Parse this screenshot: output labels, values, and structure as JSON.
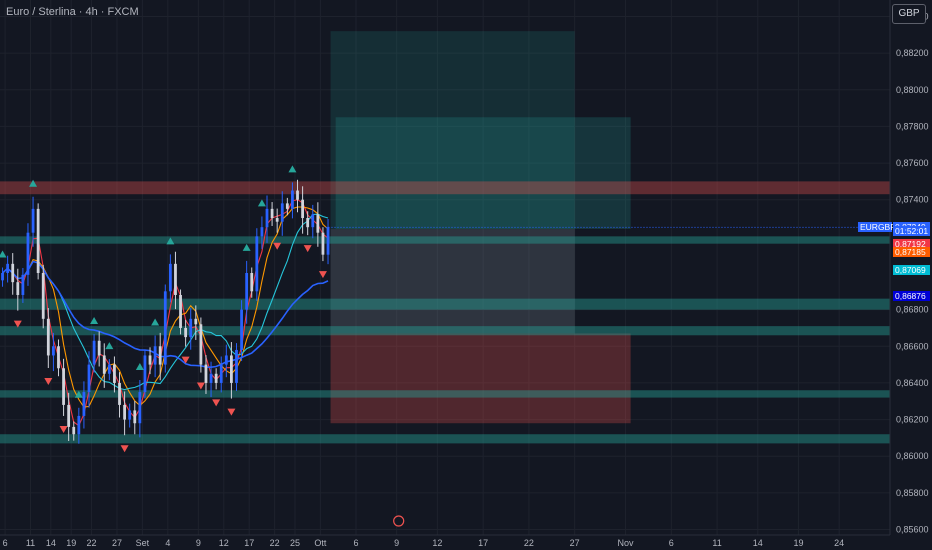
{
  "header": {
    "title": "Euro / Sterlina · 4h · FXCM",
    "currency_button": "GBP"
  },
  "colors": {
    "background": "#131722",
    "up": "#26a69a",
    "down": "#ef5350",
    "candle_up": "#2962ff",
    "candle_down": "#d1d4dc",
    "zone_teal": "#26a69a",
    "zone_red": "#ef5350"
  },
  "price_labels": {
    "symbol_tag": "EURGBP",
    "last": "0,87249",
    "countdown": "01:52:01",
    "ma_red": "0,87192",
    "ma_orange": "0,87185",
    "ma_cyan": "0,87069",
    "ma_blue": "0,86876"
  },
  "chart_data": {
    "type": "candlestick",
    "symbol": "EURGBP",
    "timeframe": "4h",
    "y_ticks": [
      "0,88400",
      "0,88200",
      "0,88000",
      "0,87800",
      "0,87600",
      "0,87400",
      "0,86800",
      "0,86600",
      "0,86400",
      "0,86200",
      "0,86000",
      "0,85800",
      "0,85600"
    ],
    "y_tick_values": [
      0.884,
      0.882,
      0.88,
      0.878,
      0.876,
      0.874,
      0.868,
      0.866,
      0.864,
      0.862,
      0.86,
      0.858,
      0.856
    ],
    "ylim": [
      0.8557,
      0.8849
    ],
    "x_ticks": [
      "6",
      "11",
      "14",
      "19",
      "22",
      "27",
      "Set",
      "4",
      "9",
      "12",
      "17",
      "22",
      "25",
      "Ott",
      "6",
      "9",
      "12",
      "17",
      "22",
      "27",
      "Nov",
      "6",
      "11",
      "14",
      "19",
      "24"
    ],
    "x_tick_index": [
      1,
      6,
      10,
      14,
      18,
      23,
      28,
      33,
      39,
      44,
      49,
      54,
      58,
      63,
      70,
      78,
      86,
      95,
      104,
      113,
      123,
      132,
      141,
      149,
      157,
      165
    ],
    "x_range": [
      0,
      175
    ],
    "trade_zones": [
      {
        "kind": "long-target",
        "from_index": 65,
        "to_index": 113,
        "top": 0.8832,
        "bottom": 0.8724
      },
      {
        "kind": "long-target-2",
        "from_index": 66,
        "to_index": 124,
        "top": 0.8785,
        "bottom": 0.8724
      },
      {
        "kind": "stop",
        "from_index": 65,
        "to_index": 124,
        "top": 0.8667,
        "bottom": 0.8618
      }
    ],
    "sr_zones": [
      {
        "color": "red",
        "top": 0.875,
        "bottom": 0.8743
      },
      {
        "color": "teal",
        "top": 0.872,
        "bottom": 0.8716
      },
      {
        "color": "teal",
        "top": 0.8686,
        "bottom": 0.868
      },
      {
        "color": "teal",
        "top": 0.8671,
        "bottom": 0.8666
      },
      {
        "color": "teal",
        "top": 0.8636,
        "bottom": 0.8632
      },
      {
        "color": "teal",
        "top": 0.8612,
        "bottom": 0.8607
      }
    ],
    "close": [
      0.87,
      0.8705,
      0.8695,
      0.8688,
      0.8699,
      0.8722,
      0.8735,
      0.87,
      0.8675,
      0.8655,
      0.866,
      0.8648,
      0.8628,
      0.8616,
      0.8612,
      0.8622,
      0.8635,
      0.865,
      0.8663,
      0.8655,
      0.8645,
      0.865,
      0.864,
      0.8628,
      0.862,
      0.8625,
      0.8618,
      0.8635,
      0.8655,
      0.865,
      0.866,
      0.865,
      0.869,
      0.8705,
      0.8688,
      0.867,
      0.8665,
      0.8675,
      0.8672,
      0.865,
      0.864,
      0.8645,
      0.864,
      0.865,
      0.8655,
      0.864,
      0.8658,
      0.868,
      0.87,
      0.869,
      0.872,
      0.8725,
      0.8735,
      0.873,
      0.8728,
      0.8738,
      0.8735,
      0.8745,
      0.874,
      0.873,
      0.8725,
      0.8732,
      0.8722,
      0.871,
      0.8725
    ],
    "moving_averages": [
      {
        "name": "red",
        "value": 0.87192
      },
      {
        "name": "orange",
        "value": 0.87185
      },
      {
        "name": "cyan",
        "value": 0.87069
      },
      {
        "name": "blue",
        "value": 0.86876
      }
    ],
    "last_price": 0.87249,
    "grid": true
  }
}
